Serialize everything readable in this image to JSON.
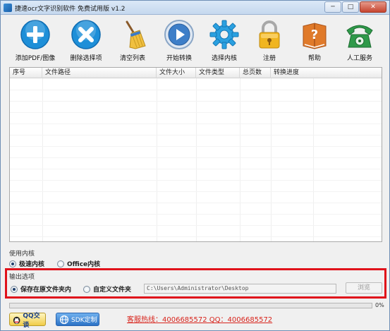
{
  "window": {
    "title": "捷速ocr文字识别软件 免费试用版 v1.2",
    "minimize": "─",
    "maximize": "□",
    "close": "✕"
  },
  "toolbar": [
    {
      "name": "add-pdf-button",
      "icon": "plus-icon",
      "label": "添加PDF/图像",
      "color": "#1e8fd8"
    },
    {
      "name": "delete-selected-button",
      "icon": "close-x-icon",
      "label": "删除选择项",
      "color": "#1e8fd8"
    },
    {
      "name": "clear-list-button",
      "icon": "broom-icon",
      "label": "清空列表",
      "color": "#e2a52a"
    },
    {
      "name": "start-convert-button",
      "icon": "play-icon",
      "label": "开始转换",
      "color": "#3d7ec8"
    },
    {
      "name": "select-kernel-button",
      "icon": "gear-icon",
      "label": "选择内核",
      "color": "#2aa0e0"
    },
    {
      "name": "register-button",
      "icon": "lock-icon",
      "label": "注册",
      "color": "#f0b520"
    },
    {
      "name": "help-button",
      "icon": "help-book-icon",
      "label": "帮助",
      "color": "#e07a2a"
    },
    {
      "name": "manual-service-button",
      "icon": "phone-icon",
      "label": "人工服务",
      "color": "#2f9a4a"
    }
  ],
  "table": {
    "columns": [
      "序号",
      "文件路径",
      "文件大小",
      "文件类型",
      "总页数",
      "转换进度"
    ],
    "rows": []
  },
  "kernel": {
    "title": "使用内核",
    "options": [
      {
        "label": "极速内核",
        "selected": true
      },
      {
        "label": "Office内核",
        "selected": false
      }
    ]
  },
  "output": {
    "title": "输出选项",
    "options": [
      {
        "label": "保存在原文件夹内",
        "selected": true
      },
      {
        "label": "自定义文件夹",
        "selected": false
      }
    ],
    "path": "C:\\Users\\Administrator\\Desktop",
    "browse_label": "浏览"
  },
  "progress": {
    "value": 0,
    "text": "0%"
  },
  "footer": {
    "qq_label": "QQ交谈",
    "sdk_label": "SDK定制",
    "hotline": "客服热线：4006685572 QQ：4006685572",
    "accent_color": "#d8231b"
  }
}
